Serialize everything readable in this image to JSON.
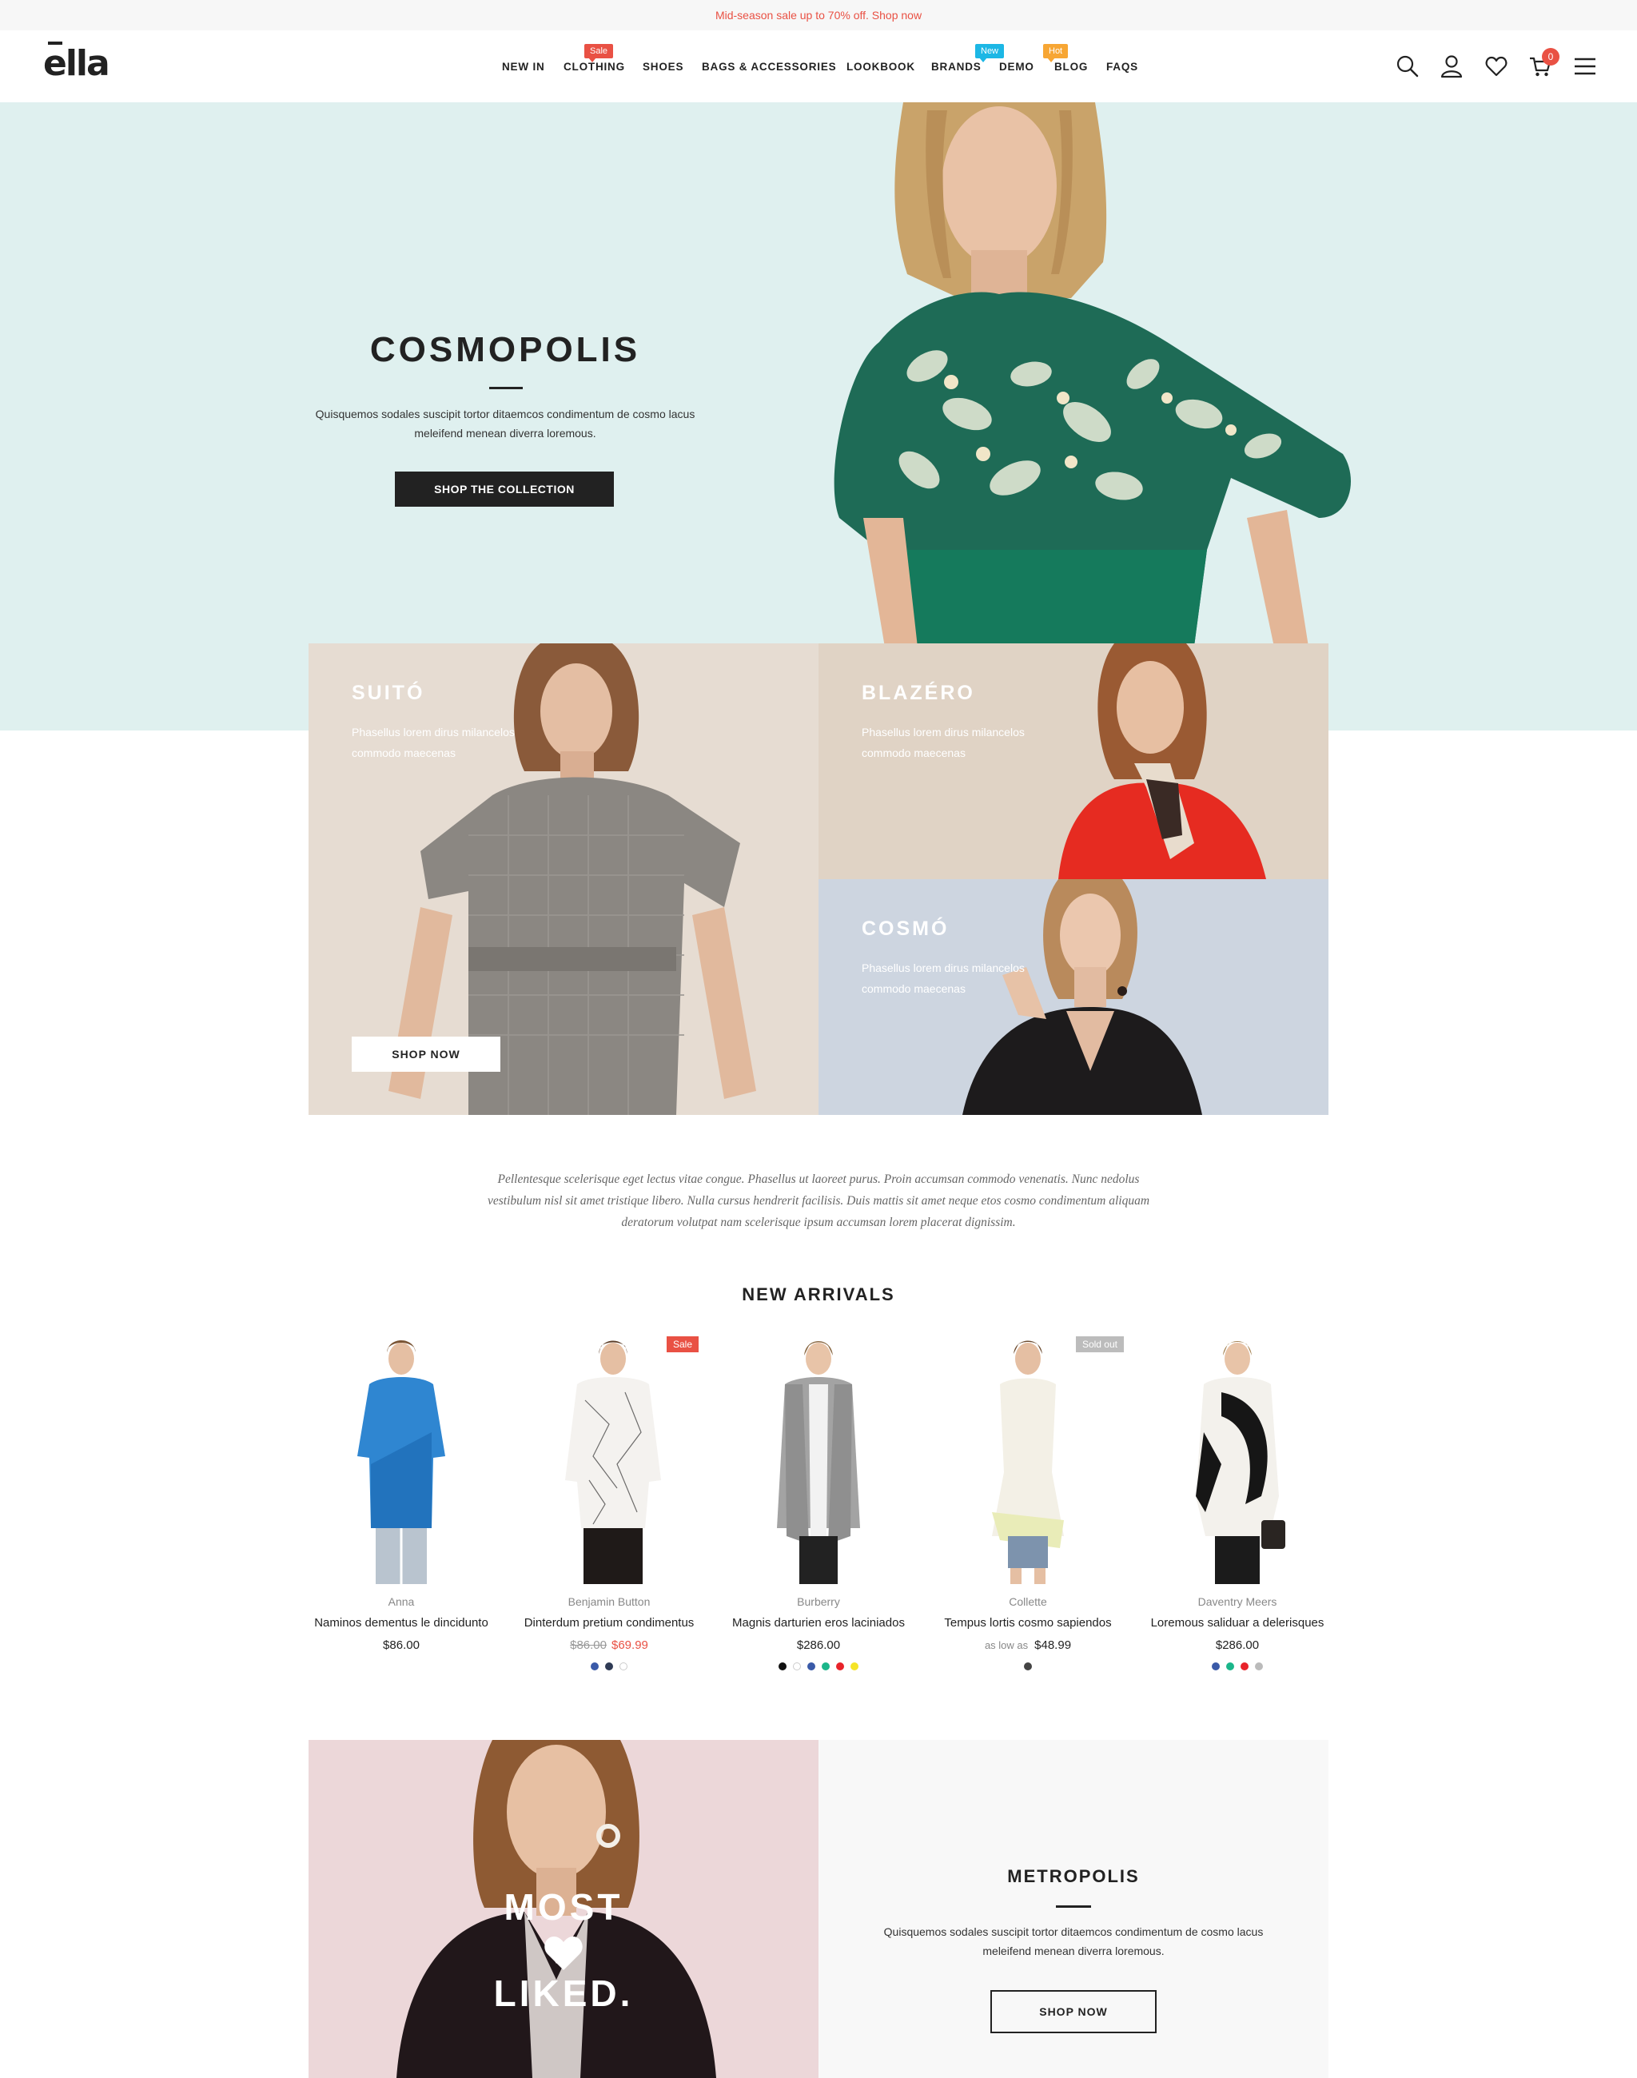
{
  "announcement": {
    "text": "Mid-season sale up to 70% off. Shop now"
  },
  "header": {
    "logo": "ella",
    "nav": [
      {
        "label": "NEW IN"
      },
      {
        "label": "CLOTHING",
        "badge": "Sale"
      },
      {
        "label": "SHOES"
      },
      {
        "label": "BAGS & ACCESSORIES"
      },
      {
        "label": "LOOKBOOK"
      },
      {
        "label": "BRANDS",
        "badge": "New"
      },
      {
        "label": "DEMO"
      },
      {
        "label": "BLOG",
        "badge": "Hot"
      },
      {
        "label": "FAQS"
      }
    ],
    "icons": [
      "search-icon",
      "user-icon",
      "heart-icon",
      "cart-icon",
      "menu-icon"
    ],
    "cart_count": "0"
  },
  "hero": {
    "title": "COSMOPOLIS",
    "text": "Quisquemos sodales suscipit tortor ditaemcos condimentum de cosmo lacus meleifend menean diverra loremous.",
    "button": "SHOP THE COLLECTION"
  },
  "banners": {
    "suito": {
      "title": "SUITÓ",
      "text": "Phasellus lorem dirus milancelos commodo maecenas",
      "button": "SHOP NOW"
    },
    "blazero": {
      "title": "BLAZÉRO",
      "text": "Phasellus lorem dirus milancelos commodo maecenas"
    },
    "cosmo": {
      "title": "COSMÓ",
      "text": "Phasellus lorem dirus milancelos commodo maecenas"
    }
  },
  "intro": "Pellentesque scelerisque eget lectus vitae congue. Phasellus ut laoreet purus. Proin accumsan commodo venenatis. Nunc nedolus vestibulum nisl sit amet tristique libero. Nulla cursus hendrerit facilisis. Duis mattis sit amet neque etos cosmo condimentum aliquam deratorum volutpat nam scelerisque ipsum accumsan lorem placerat dignissim.",
  "new_arrivals": {
    "title": "NEW ARRIVALS",
    "products": [
      {
        "vendor": "Anna",
        "name": "Naminos dementus le dincidunto",
        "price": "$86.00",
        "swatches": []
      },
      {
        "vendor": "Benjamin Button",
        "name": "Dinterdum pretium condimentus",
        "old_price": "$86.00",
        "price": "$69.99",
        "badge": "Sale",
        "swatches": [
          "#3a5aa8",
          "#2f3b55",
          "#ffffff"
        ]
      },
      {
        "vendor": "Burberry",
        "name": "Magnis darturien eros laciniados",
        "price": "$286.00",
        "swatches": [
          "#111111",
          "#ffffff",
          "#3a5aa8",
          "#1bb68a",
          "#e8232a",
          "#f5e427"
        ]
      },
      {
        "vendor": "Collette",
        "name": "Tempus lortis cosmo sapiendos",
        "price_prefix": "as low as",
        "price": "$48.99",
        "badge": "Sold out",
        "swatches": [
          "#444444"
        ]
      },
      {
        "vendor": "Daventry Meers",
        "name": "Loremous saliduar a delerisques",
        "price": "$286.00",
        "swatches": [
          "#3a5aa8",
          "#1bb68a",
          "#e8232a",
          "#bbbbbb"
        ]
      }
    ]
  },
  "most_liked": {
    "line1": "MOST",
    "line2": "LIKED."
  },
  "metropolis": {
    "title": "METROPOLIS",
    "text": "Quisquemos sodales suscipit tortor ditaemcos condimentum de cosmo lacus meleifend menean diverra loremous.",
    "button": "SHOP NOW"
  },
  "colors": {
    "accent": "#e95144",
    "dark": "#222222",
    "hero_bg": "#dff0ef"
  }
}
